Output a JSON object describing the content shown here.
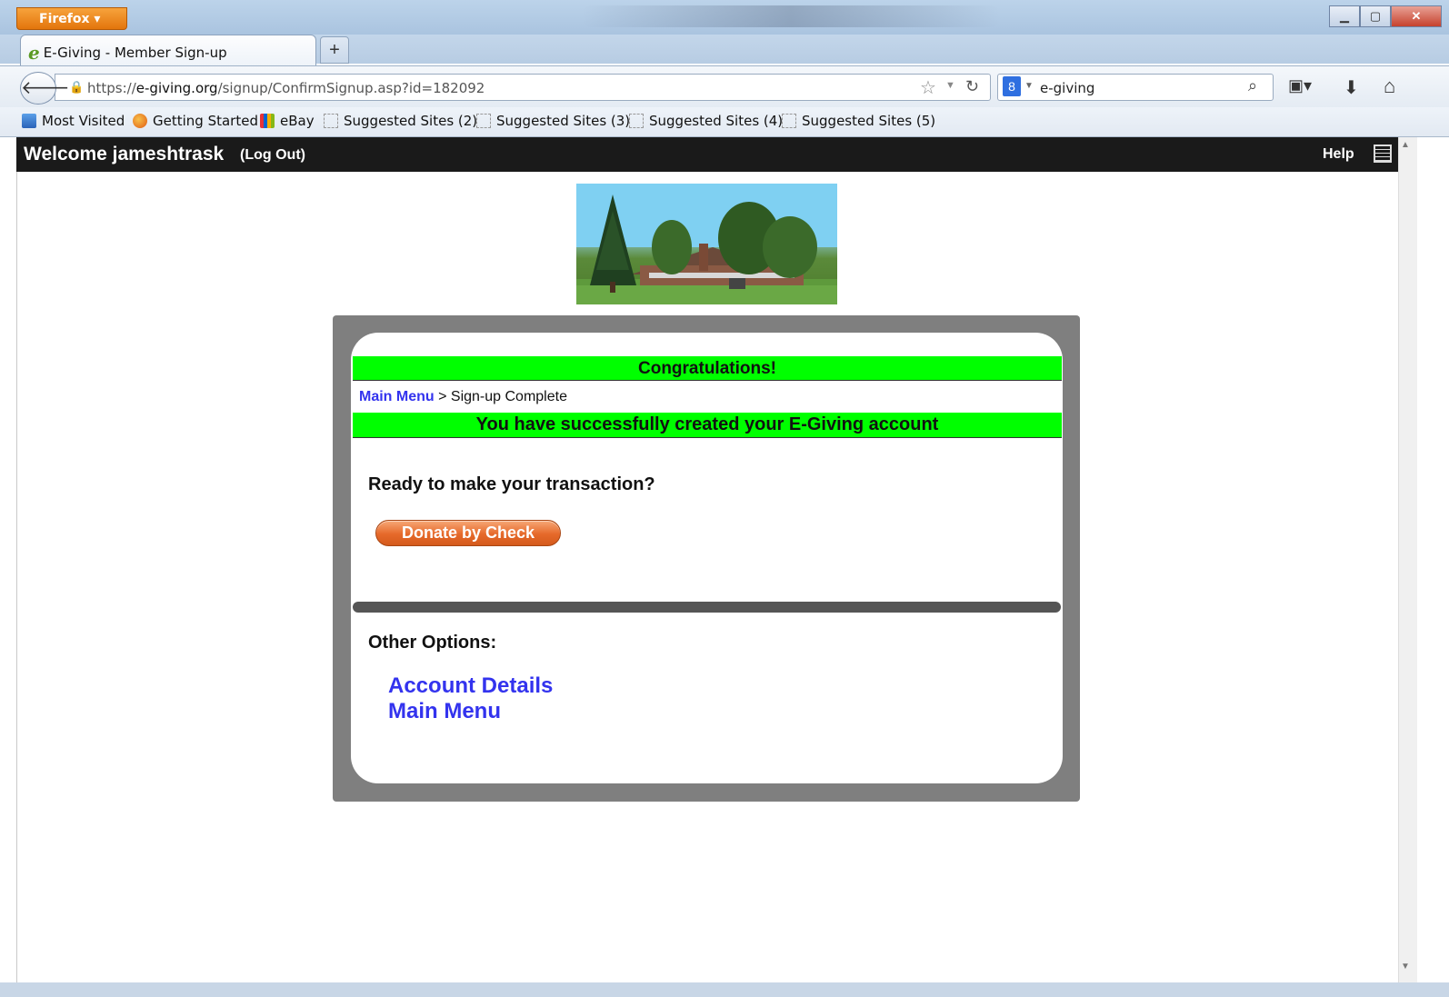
{
  "browser": {
    "app_button": "Firefox ▾",
    "tab_title": "E-Giving - Member Sign-up",
    "new_tab": "+",
    "url_prefix": "https://",
    "url_domain": "e-giving.org",
    "url_path": "/signup/ConfirmSignup.asp?id=182092",
    "search_value": "e-giving",
    "bookmarks": [
      {
        "label": "Most Visited",
        "icon": "most-visited-icon"
      },
      {
        "label": "Getting Started",
        "icon": "firefox-icon"
      },
      {
        "label": "eBay",
        "icon": "ebay-icon"
      },
      {
        "label": "Suggested Sites (2)",
        "icon": "page-icon"
      },
      {
        "label": "Suggested Sites (3)",
        "icon": "page-icon"
      },
      {
        "label": "Suggested Sites (4)",
        "icon": "page-icon"
      },
      {
        "label": "Suggested Sites (5)",
        "icon": "page-icon"
      }
    ]
  },
  "header": {
    "welcome": "Welcome jameshtrask",
    "logout": "(Log Out)",
    "help": "Help"
  },
  "main": {
    "congrats": "Congratulations!",
    "breadcrumb_link": "Main Menu",
    "breadcrumb_sep": " > ",
    "breadcrumb_current": "Sign-up Complete",
    "success": "You have successfully created your E-Giving account",
    "ready": "Ready to make your transaction?",
    "donate_button": "Donate by Check",
    "other_options": "Other Options:",
    "link_account": "Account Details",
    "link_main": "Main Menu"
  },
  "colors": {
    "accent_green": "#00ff00",
    "link_blue": "#3333ee",
    "button_orange": "#e6692a",
    "header_bg": "#1a1a1a"
  }
}
